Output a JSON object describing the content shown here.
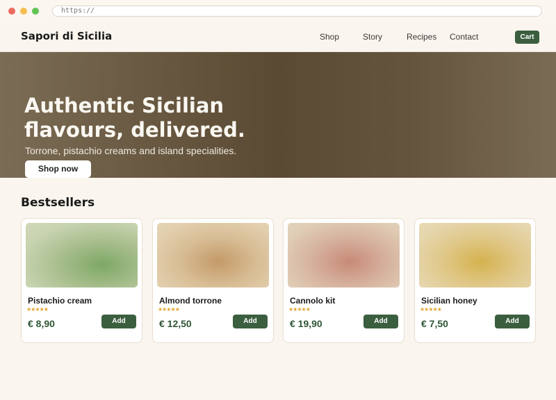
{
  "browser": {
    "url": "https://"
  },
  "nav": {
    "brand": "Sapori di Sicilia",
    "links": [
      "Shop",
      "Story",
      "Recipes",
      "Contact"
    ],
    "cart_label": "Cart"
  },
  "hero": {
    "title": "Authentic Sicilian flavours, delivered.",
    "subtitle": "Torrone, pistachio creams and island specialities.",
    "cta_label": "Shop now"
  },
  "bestsellers": {
    "title": "Bestsellers",
    "products": [
      {
        "name": "Pistachio cream",
        "rating": 5,
        "price": "€ 8,90",
        "add_label": "Add",
        "image_icon": "product-photo"
      },
      {
        "name": "Almond torrone",
        "rating": 5,
        "price": "€ 12,50",
        "add_label": "Add",
        "image_icon": "product-photo"
      },
      {
        "name": "Cannolo kit",
        "rating": 5,
        "price": "€ 19,90",
        "add_label": "Add",
        "image_icon": "product-photo"
      },
      {
        "name": "Sicilian honey",
        "rating": 5,
        "price": "€ 7,50",
        "add_label": "Add",
        "image_icon": "product-photo"
      }
    ]
  },
  "colors": {
    "accent": "#3b5e3f",
    "background": "#faf5ee",
    "star": "#e2a52d"
  }
}
